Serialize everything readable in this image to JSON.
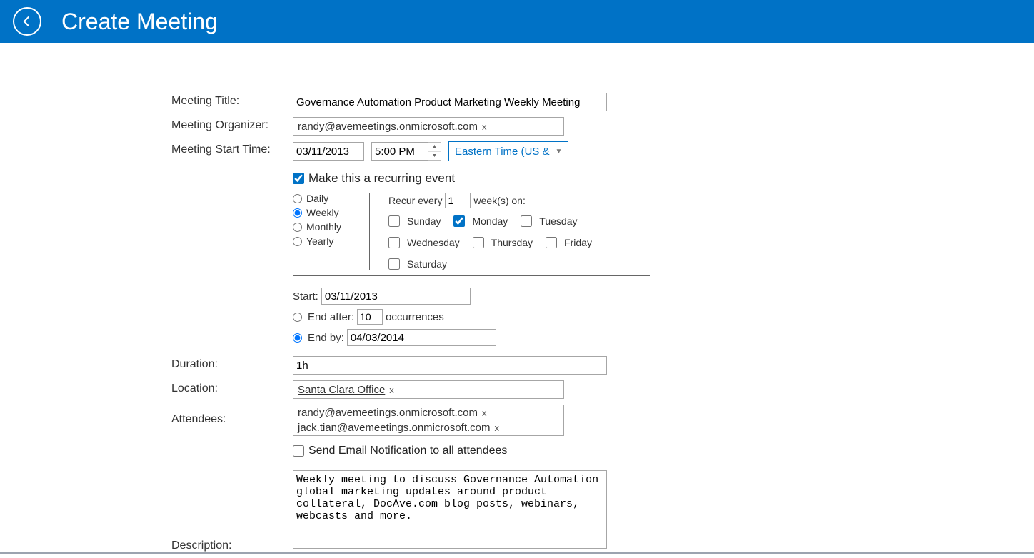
{
  "header": {
    "title": "Create Meeting"
  },
  "labels": {
    "title": "Meeting Title:",
    "organizer": "Meeting Organizer:",
    "start": "Meeting Start Time:",
    "recurring": "Make this a recurring event",
    "duration": "Duration:",
    "location": "Location:",
    "attendees": "Attendees:",
    "sendEmail": "Send Email Notification to all attendees",
    "description": "Description:"
  },
  "fields": {
    "title": "Governance Automation Product Marketing Weekly Meeting",
    "organizer": "randy@avemeetings.onmicrosoft.com",
    "startDate": "03/11/2013",
    "startTime": "5:00 PM",
    "timezone": "Eastern Time (US &",
    "recurring": true,
    "duration": "1h",
    "location": "Santa Clara Office",
    "attendees": [
      "randy@avemeetings.onmicrosoft.com",
      "jack.tian@avemeetings.onmicrosoft.com"
    ],
    "sendEmail": false,
    "description": "Weekly meeting to discuss Governance Automation global marketing updates around product collateral, DocAve.com blog posts, webinars, webcasts and more."
  },
  "recurrence": {
    "freq": {
      "daily": "Daily",
      "weekly": "Weekly",
      "monthly": "Monthly",
      "yearly": "Yearly",
      "selected": "weekly"
    },
    "everyPrefix": "Recur every",
    "everyValue": "1",
    "everySuffix": "week(s) on:",
    "days": {
      "sunday": "Sunday",
      "monday": "Monday",
      "tuesday": "Tuesday",
      "wednesday": "Wednesday",
      "thursday": "Thursday",
      "friday": "Friday",
      "saturday": "Saturday",
      "checked": [
        "monday"
      ]
    },
    "range": {
      "startLabel": "Start:",
      "startDate": "03/11/2013",
      "endAfterLabel": "End after:",
      "endAfterValue": "10",
      "endAfterSuffix": "occurrences",
      "endByLabel": "End by:",
      "endByDate": "04/03/2014",
      "selected": "endBy"
    }
  }
}
